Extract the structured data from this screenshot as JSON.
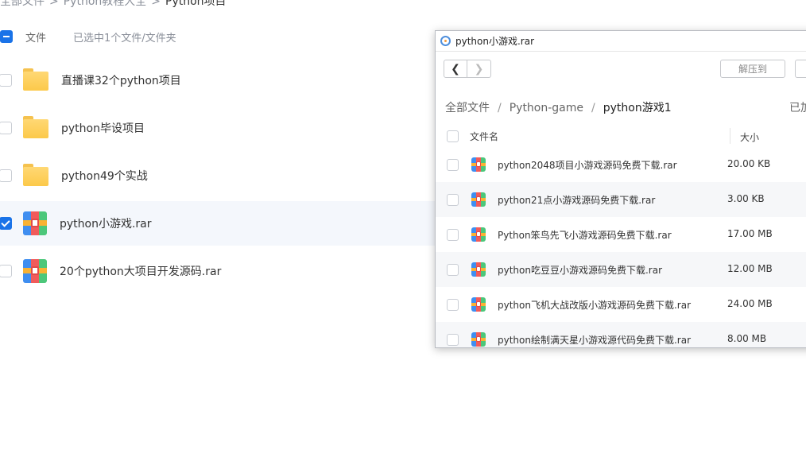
{
  "breadcrumb": {
    "items": [
      "全部文件",
      "Python教程大全"
    ],
    "current": "Python项目"
  },
  "list_header": {
    "name_label": "文件",
    "selection_text": "已选中1个文件/文件夹"
  },
  "files": [
    {
      "name": "直播课32个python项目",
      "type": "folder",
      "selected": false
    },
    {
      "name": "python毕设项目",
      "type": "folder",
      "selected": false
    },
    {
      "name": "python49个实战",
      "type": "folder",
      "selected": false
    },
    {
      "name": "python小游戏.rar",
      "type": "archive",
      "selected": true
    },
    {
      "name": "20个python大项目开发源码.rar",
      "type": "archive",
      "selected": false
    }
  ],
  "viewer": {
    "title": "python小游戏.rar",
    "extract_label": "解压到",
    "crumbs": [
      "全部文件",
      "Python-game"
    ],
    "current": "python游戏1",
    "crumb_right": "已加",
    "columns": {
      "name": "文件名",
      "size": "大小"
    },
    "rows": [
      {
        "name": "python2048项目小游戏源码免费下载.rar",
        "size": "20.00 KB"
      },
      {
        "name": "python21点小游戏源码免费下载.rar",
        "size": "3.00 KB"
      },
      {
        "name": "Python笨鸟先飞小游戏源码免费下载.rar",
        "size": "17.00 MB"
      },
      {
        "name": "python吃豆豆小游戏源码免费下载.rar",
        "size": "12.00 MB"
      },
      {
        "name": "python飞机大战改版小游戏源码免费下载.rar",
        "size": "24.00 MB"
      },
      {
        "name": "python绘制满天星小游戏源代码免费下载.rar",
        "size": "8.00 MB"
      }
    ]
  },
  "colors": {
    "accent": "#1a73e8",
    "folder": "#fcc94a"
  },
  "icons": {
    "folder": "folder-icon",
    "archive": "rar-archive-icon",
    "back": "chevron-left-icon",
    "forward": "chevron-right-icon",
    "app": "archive-app-icon"
  }
}
